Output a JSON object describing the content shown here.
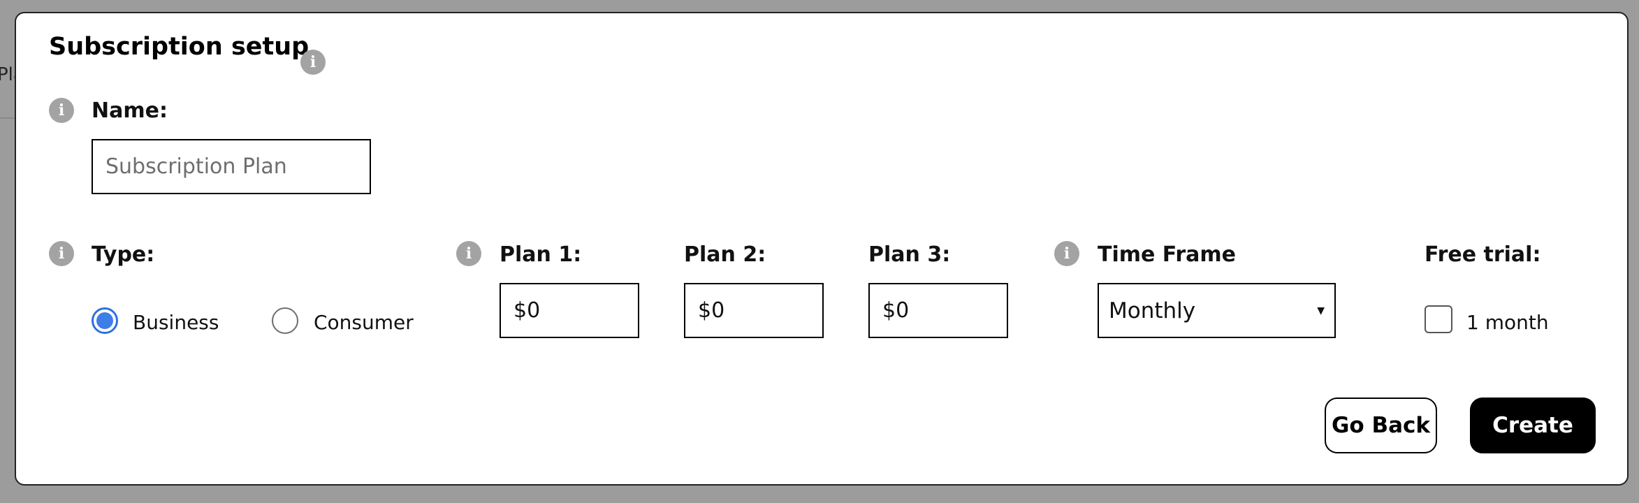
{
  "backdrop": {
    "text": "Pla"
  },
  "modal": {
    "title": "Subscription setup",
    "name": {
      "label": "Name:",
      "placeholder": "Subscription Plan",
      "value": ""
    },
    "type": {
      "label": "Type:",
      "options": [
        {
          "label": "Business",
          "selected": true
        },
        {
          "label": "Consumer",
          "selected": false
        }
      ]
    },
    "plans": [
      {
        "label": "Plan 1:",
        "value": "$0"
      },
      {
        "label": "Plan 2:",
        "value": "$0"
      },
      {
        "label": "Plan 3:",
        "value": "$0"
      }
    ],
    "time_frame": {
      "label": "Time Frame",
      "selected": "Monthly"
    },
    "free_trial": {
      "label": "Free trial:",
      "option_label": "1 month",
      "checked": false
    },
    "buttons": {
      "go_back": "Go Back",
      "create": "Create"
    },
    "icons": {
      "info": "i"
    }
  },
  "colors": {
    "backdrop": "#9c9c9c",
    "radio_accent": "#3d7ee8",
    "info_icon": "#a3a3a3",
    "primary_button": "#000000"
  }
}
